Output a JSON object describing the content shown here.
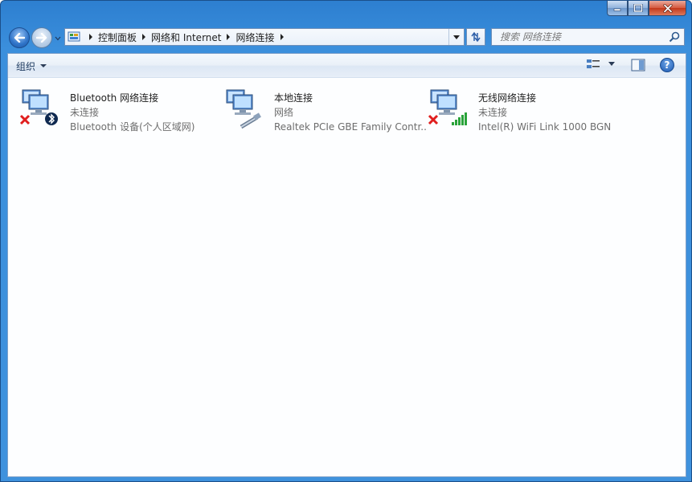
{
  "window": {
    "caption": {
      "minimize": "minimize-icon",
      "maximize": "maximize-icon",
      "close": "close-icon"
    }
  },
  "nav": {
    "breadcrumbs": [
      "控制面板",
      "网络和 Internet",
      "网络连接"
    ],
    "search_placeholder": "搜索 网络连接"
  },
  "toolbar": {
    "organize_label": "组织"
  },
  "connections": [
    {
      "name": "Bluetooth 网络连接",
      "status": "未连接",
      "device": "Bluetooth 设备(个人区域网)",
      "status_icon": "disconnected-x-icon",
      "type_icon": "bluetooth-icon"
    },
    {
      "name": "本地连接",
      "status": "网络",
      "device": "Realtek PCIe GBE Family Contr...",
      "status_icon": "",
      "type_icon": "ethernet-cable-icon"
    },
    {
      "name": "无线网络连接",
      "status": "未连接",
      "device": "Intel(R) WiFi Link 1000 BGN",
      "status_icon": "disconnected-x-icon",
      "type_icon": "wifi-signal-icon"
    }
  ],
  "colors": {
    "title_bar": "#3b8fdc",
    "close_button": "#c3381b",
    "error_red": "#e01e1e",
    "signal_green": "#2aa33a"
  }
}
